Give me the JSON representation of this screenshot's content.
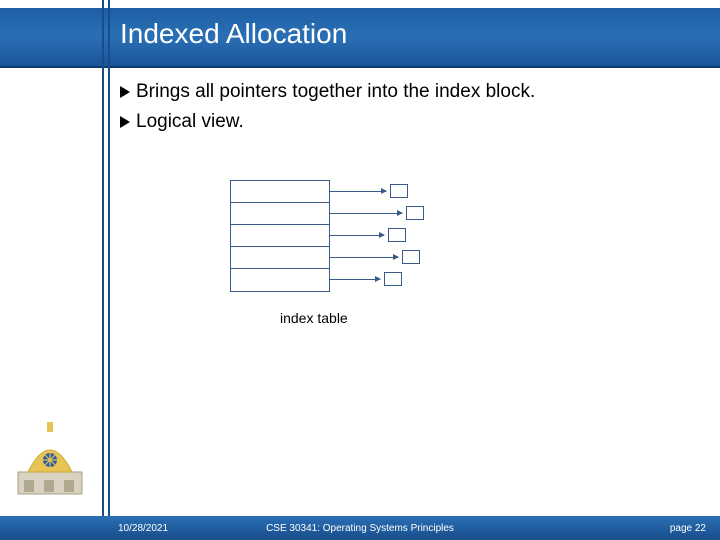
{
  "title": "Indexed Allocation",
  "bullets": [
    "Brings all pointers together into the index block.",
    "Logical view."
  ],
  "diagram": {
    "label": "index table",
    "row_count": 5,
    "block_count": 5
  },
  "footer": {
    "date": "10/28/2021",
    "course": "CSE 30341: Operating Systems Principles",
    "page_label": "page 22"
  },
  "colors": {
    "band_blue": "#1d5fa6",
    "line_blue": "#184d8a"
  }
}
